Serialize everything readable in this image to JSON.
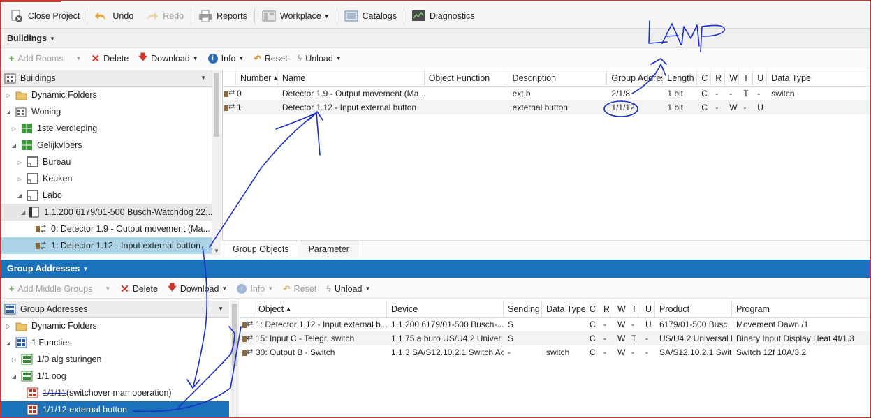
{
  "toolbar": {
    "close_project": "Close Project",
    "undo": "Undo",
    "redo": "Redo",
    "reports": "Reports",
    "workplace": "Workplace",
    "catalogs": "Catalogs",
    "diagnostics": "Diagnostics"
  },
  "buildings_panel": {
    "title": "Buildings",
    "actions": {
      "add_rooms": "Add Rooms",
      "delete": "Delete",
      "download": "Download",
      "info": "Info",
      "reset": "Reset",
      "unload": "Unload"
    },
    "tree_header": "Buildings",
    "tree": [
      {
        "label": "Dynamic Folders"
      },
      {
        "label": "Woning"
      },
      {
        "label": "1ste Verdieping"
      },
      {
        "label": "Gelijkvloers"
      },
      {
        "label": "Bureau"
      },
      {
        "label": "Keuken"
      },
      {
        "label": "Labo"
      },
      {
        "label": "1.1.200 6179/01-500 Busch-Watchdog 22..."
      },
      {
        "label": "0: Detector 1.9 - Output movement (Ma..."
      },
      {
        "label": "1: Detector 1.12 - Input external button -"
      }
    ],
    "grid_columns": [
      "Number",
      "Name",
      "Object Function",
      "Description",
      "Group Address",
      "Length",
      "C",
      "R",
      "W",
      "T",
      "U",
      "Data Type"
    ],
    "grid_rows": [
      {
        "number": "0",
        "name": "Detector 1.9 - Output movement (Ma...",
        "function": "",
        "description": "ext b",
        "group_address": "2/1/8",
        "length": "1 bit",
        "c": "C",
        "r": "-",
        "w": "-",
        "t": "T",
        "u": "-",
        "data_type": "switch"
      },
      {
        "number": "1",
        "name": "Detector 1.12 - Input external button",
        "function": "",
        "description": "external button",
        "group_address": "1/1/12",
        "length": "1 bit",
        "c": "C",
        "r": "-",
        "w": "W",
        "t": "-",
        "u": "U",
        "data_type": ""
      }
    ],
    "tabs": [
      "Group Objects",
      "Parameter"
    ]
  },
  "group_addresses_panel": {
    "title": "Group Addresses",
    "actions": {
      "add_middle_groups": "Add Middle Groups",
      "delete": "Delete",
      "download": "Download",
      "info": "Info",
      "reset": "Reset",
      "unload": "Unload"
    },
    "tree_header": "Group Addresses",
    "tree": [
      {
        "label": "Dynamic Folders"
      },
      {
        "label": "1 Functies"
      },
      {
        "label": "1/0 alg sturingen"
      },
      {
        "label": "1/1 oog"
      },
      {
        "label_code": "1/1/11",
        "label_rest": " (switchover man operation)"
      },
      {
        "label": "1/1/12 external button"
      }
    ],
    "grid_columns": [
      "Object",
      "Device",
      "Sending",
      "Data Type",
      "C",
      "R",
      "W",
      "T",
      "U",
      "Product",
      "Program"
    ],
    "grid_rows": [
      {
        "object": "1: Detector 1.12 - Input external b...",
        "device": "1.1.200 6179/01-500 Busch-...",
        "sending": "S",
        "data_type": "",
        "c": "C",
        "r": "-",
        "w": "W",
        "t": "-",
        "u": "U",
        "product": "6179/01-500 Busc...",
        "program": "Movement Dawn /1"
      },
      {
        "object": "15: Input C - Telegr. switch",
        "device": "1.1.75 a buro US/U4.2 Univer...",
        "sending": "S",
        "data_type": "",
        "c": "C",
        "r": "-",
        "w": "W",
        "t": "T",
        "u": "-",
        "product": "US/U4.2 Universal I...",
        "program": "Binary Input Display Heat 4f/1.3"
      },
      {
        "object": "30: Output B - Switch",
        "device": "1.1.3 SA/S12.10.2.1 Switch Ac...",
        "sending": "-",
        "data_type": "switch",
        "c": "C",
        "r": "-",
        "w": "W",
        "t": "-",
        "u": "-",
        "product": "SA/S12.10.2.1 Swit...",
        "program": "Switch 12f 10A/3.2"
      }
    ]
  },
  "annotation": {
    "text": "LAMP"
  },
  "colors": {
    "accent": "#1a73ba",
    "selection": "#aad3e6",
    "ink": "#1b2fc8",
    "delete_red": "#d23a2a",
    "download_red": "#c8372d"
  }
}
